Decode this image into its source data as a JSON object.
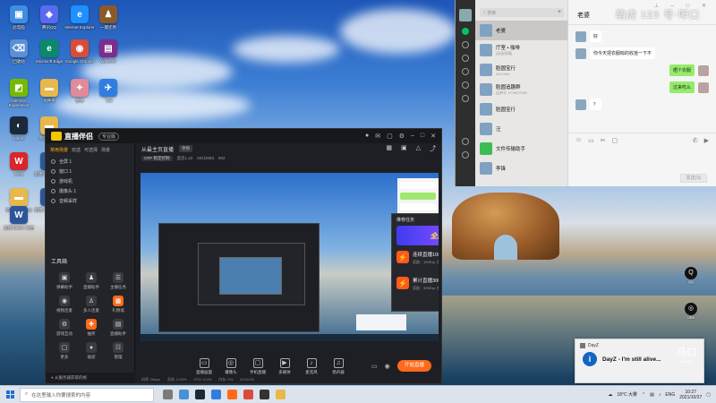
{
  "desktop": {
    "icons_left": [
      {
        "label": "此电脑",
        "color": "#3d8de0",
        "glyph": "▣"
      },
      {
        "label": "腾讯QQ",
        "color": "#5a6af0",
        "glyph": "◈"
      },
      {
        "label": "Internet Explorer",
        "color": "#1e90ff",
        "glyph": "e"
      },
      {
        "label": "一键还原",
        "color": "#8a5a2a",
        "glyph": "♟"
      },
      {
        "label": "回收站",
        "color": "#5b8fd6",
        "glyph": "⌫"
      },
      {
        "label": "Microsoft Edge",
        "color": "#0a8a6a",
        "glyph": "e"
      },
      {
        "label": "Google Chrome",
        "color": "#d84c3b",
        "glyph": "◉"
      },
      {
        "label": "WinRAR",
        "color": "#7a2e8e",
        "glyph": "▤"
      },
      {
        "label": "GeForce Experience",
        "color": "#76b900",
        "glyph": "◩"
      },
      {
        "label": "文件夹",
        "color": "#e8b84a",
        "glyph": "▬"
      },
      {
        "label": "原神",
        "color": "#e08a9a",
        "glyph": "✦"
      },
      {
        "label": "飞书",
        "color": "#2f7de1",
        "glyph": "✈"
      },
      {
        "label": "Steam",
        "color": "#1b2838",
        "glyph": "◐"
      },
      {
        "label": "新建文件夹",
        "color": "#e8b84a",
        "glyph": "▬"
      },
      {
        "label": "WPS",
        "color": "#d8262b",
        "glyph": "W"
      },
      {
        "label": "新建 DOCX 文档",
        "color": "#2b579a",
        "glyph": "W"
      },
      {
        "label": "新建文件夹 (2)",
        "color": "#e8b84a",
        "glyph": "▬"
      },
      {
        "label": "新建 DOCX 文档",
        "color": "#2b579a",
        "glyph": "W"
      },
      {
        "label": "新建 DOCX 文档",
        "color": "#2b579a",
        "glyph": "W"
      }
    ],
    "icons_right": [
      {
        "label": "QQ",
        "glyph": "Q"
      },
      {
        "label": "OBS",
        "glyph": "◎"
      }
    ]
  },
  "stream_app": {
    "app_name": "直播伴侣",
    "version": "专业版",
    "left_tabs": [
      "常用场景",
      "双选",
      "可选择",
      "场景"
    ],
    "scenes": [
      "全屏 1",
      "窗口 1",
      "游戏机",
      "摄像头 1",
      "音频采样"
    ],
    "toolbox_title": "工具箱",
    "tools": [
      {
        "label": "弹幕助手",
        "glyph": "▣",
        "hot": false
      },
      {
        "label": "直播助手",
        "glyph": "♟",
        "hot": false
      },
      {
        "label": "主播任务",
        "glyph": "☰",
        "hot": false
      },
      {
        "label": "视频连麦",
        "glyph": "◉",
        "hot": false
      },
      {
        "label": "多人连麦",
        "glyph": "♙",
        "hot": false
      },
      {
        "label": "礼物墙",
        "glyph": "▦",
        "hot": true
      },
      {
        "label": "游戏互动",
        "glyph": "⚙",
        "hot": false
      },
      {
        "label": "抽奖",
        "glyph": "✚",
        "hot": true
      },
      {
        "label": "直播助手",
        "glyph": "▤",
        "hot": false
      },
      {
        "label": "更多",
        "glyph": "▢",
        "hot": false
      },
      {
        "label": "福袋",
        "glyph": "♦",
        "hot": false
      },
      {
        "label": "管理",
        "glyph": "☷",
        "hot": false
      }
    ],
    "footer_warning": "从服务器获取的帧",
    "room_title": "从最主页直播",
    "room_tag": "更换",
    "room_sub": [
      "CRF 稳定控制",
      "直连1.23",
      "601/2083",
      "902"
    ],
    "popup": {
      "title": "推荐任务",
      "banner": "全民乐PK",
      "tasks": [
        {
          "title": "连续直播100分钟",
          "sub": "奖励：100Exp 主播任务 x1",
          "state": "领取"
        },
        {
          "title": "累计直播300分钟",
          "sub": "奖励：300Exp 主播任务 x1",
          "state": "未完成"
        }
      ]
    },
    "bottom_buttons": [
      {
        "label": "直播画面",
        "glyph": "▭"
      },
      {
        "label": "摄像头",
        "glyph": "◎"
      },
      {
        "label": "手机直播",
        "glyph": "▢"
      },
      {
        "label": "多媒体",
        "glyph": "▶"
      },
      {
        "label": "麦克风",
        "glyph": "♪"
      },
      {
        "label": "扬声器",
        "glyph": "♫"
      }
    ],
    "go_live_label": "开始直播",
    "stats": [
      "码率: 0kbps",
      "丢帧: 0.00%",
      "CPU: 0.0%",
      "内存: 0%",
      "00:00:00"
    ]
  },
  "wechat": {
    "search_placeholder": "搜索",
    "add_label": "+",
    "chats": [
      {
        "name": "老婆",
        "message": "",
        "selected": true,
        "green": false
      },
      {
        "name": "厅室 • 咖啡",
        "message": "[动画表情]",
        "selected": false,
        "green": false
      },
      {
        "name": "脸圆宝行",
        "message": "A15 Mini",
        "selected": false,
        "green": false
      },
      {
        "name": "脸圆追趣群",
        "message": "运单号 1278037400",
        "selected": false,
        "green": false
      },
      {
        "name": "脸圆宝行",
        "message": "",
        "selected": false,
        "green": false
      },
      {
        "name": "汪",
        "message": "",
        "selected": false,
        "green": false
      },
      {
        "name": "文件传输助手",
        "message": "",
        "selected": false,
        "green": true
      },
      {
        "name": "李锋",
        "message": "",
        "selected": false,
        "green": false
      }
    ],
    "chat_title": "老婆",
    "messages": [
      {
        "text": "好",
        "me": false
      },
      {
        "text": "你今天把衣服晾的收拾一下不",
        "me": false
      },
      {
        "text": "晒个衣服",
        "me": true
      },
      {
        "text": "过来吃么",
        "me": true
      },
      {
        "text": "？",
        "me": false
      }
    ],
    "send_label": "发送(S)"
  },
  "watermark": "萌虎 123 号·叩口",
  "notification": {
    "app": "DayZ",
    "text": "DayZ - I'm still alive..."
  },
  "brand_wm": {
    "main": "马口",
    "sub": "8212083"
  },
  "taskbar": {
    "search_placeholder": "在这里输入你要搜索的内容",
    "apps": [
      "#7a7a7a",
      "#4a90d9",
      "#1b2838",
      "#2f7de1",
      "#ff6a1a",
      "#d84c3b",
      "#333333",
      "#e8b84a"
    ],
    "tray_text": "18°C 大雾",
    "lang": "ENG",
    "time": "10:27",
    "date": "2021/10/27"
  }
}
